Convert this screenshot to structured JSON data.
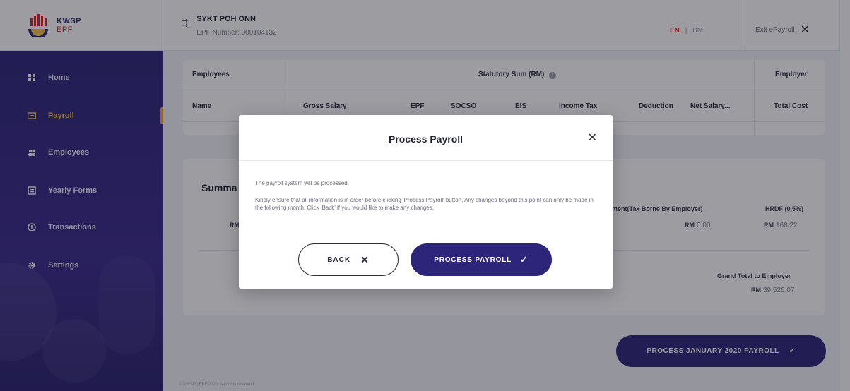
{
  "brand": {
    "logo_line1": "KWSP",
    "logo_line2": "EPF"
  },
  "sidebar": {
    "items": [
      {
        "label": "Home",
        "icon": "home-icon"
      },
      {
        "label": "Payroll",
        "icon": "payroll-icon",
        "active": true
      },
      {
        "label": "Employees",
        "icon": "employees-icon"
      },
      {
        "label": "Yearly Forms",
        "icon": "forms-icon"
      },
      {
        "label": "Transactions",
        "icon": "transactions-icon"
      },
      {
        "label": "Settings",
        "icon": "settings-icon"
      }
    ]
  },
  "header": {
    "company_name": "SYKT POH ONN",
    "epf_number": "EPF Number: 000104132",
    "lang_en": "EN",
    "lang_sep": "|",
    "lang_bm": "BM",
    "exit_label": "Exit ePayroll"
  },
  "table": {
    "group_employees": "Employees",
    "group_statutory": "Statutory Sum (RM)",
    "group_employer": "Employer",
    "columns": [
      "Name",
      "Gross Salary",
      "EPF",
      "SOCSO",
      "EIS",
      "Income Tax",
      "Deduction",
      "Net Salary...",
      "Total Cost"
    ]
  },
  "summary": {
    "title": "Summa",
    "left_value_prefix": "RM",
    "col_tax_label": "ment(Tax Borne By Employer)",
    "col_tax_value": "0.00",
    "col_hrdf_label": "HRDF (0.5%)",
    "col_hrdf_value": "168.22",
    "grand_total_label": "Grand Total to Employer",
    "grand_total_value": "39,526.07",
    "currency": "RM"
  },
  "footer": {
    "copyright": "© KWSP | EPF 2020. All rights reserved"
  },
  "primary_action": {
    "label": "PROCESS JANUARY 2020 PAYROLL"
  },
  "modal": {
    "title": "Process Payroll",
    "line1": "The payroll system will be processed.",
    "line2": "Kindly ensure that all information is in order before clicking 'Process Payroll' button. Any changes beyond this point can only be made in the following month. Click 'Back' if you would like to make any changes.",
    "back_label": "BACK",
    "process_label": "PROCESS PAYROLL"
  },
  "colors": {
    "primary": "#2d2579",
    "accent_active": "#f5c44a",
    "lang_active": "#e02020"
  }
}
